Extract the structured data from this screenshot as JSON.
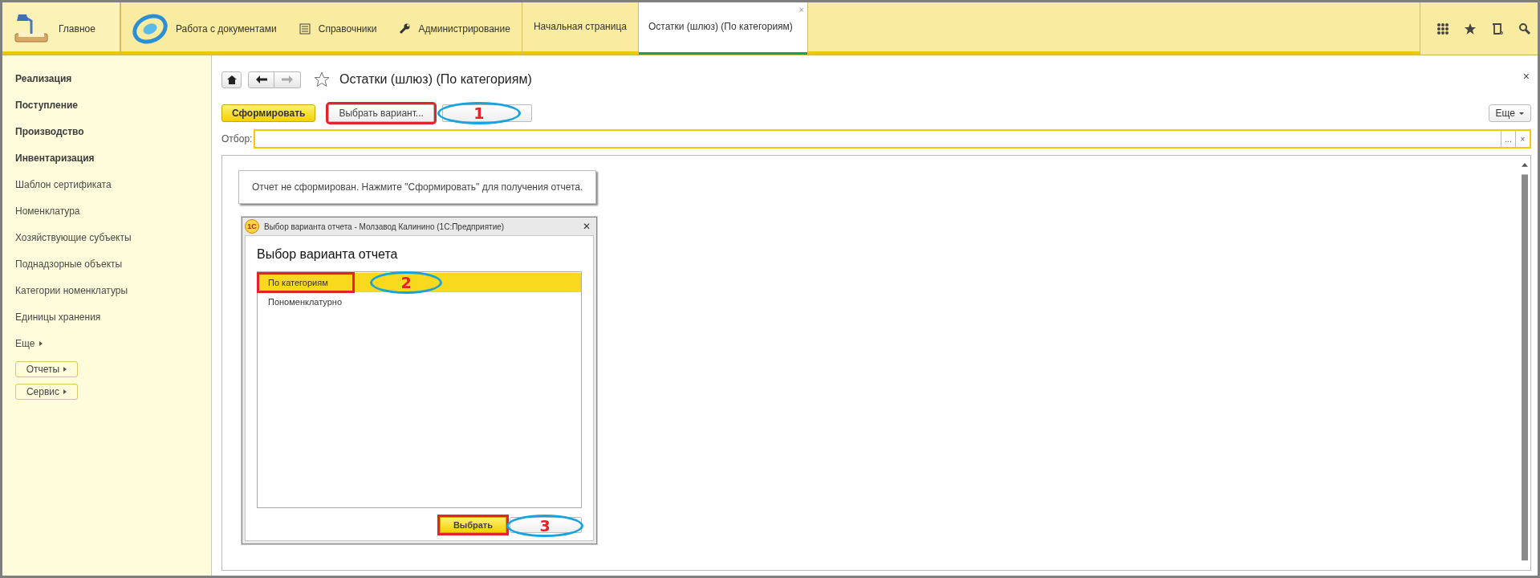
{
  "sections": [
    {
      "label": "Главное",
      "selected": false
    },
    {
      "label": "Работа с документами",
      "selected": false
    },
    {
      "label": "Справочники",
      "selected": false
    },
    {
      "label": "Администрирование",
      "selected": false
    }
  ],
  "open_tabs": [
    {
      "label": "Начальная страница",
      "selected": false
    },
    {
      "label": "Остатки (шлюз) (По категориям)",
      "selected": true,
      "close": "×"
    }
  ],
  "sidebar": {
    "items": [
      {
        "label": "Реализация",
        "bold": true
      },
      {
        "label": "Поступление",
        "bold": true
      },
      {
        "label": "Производство",
        "bold": true
      },
      {
        "label": "Инвентаризация",
        "bold": true
      },
      {
        "label": "Шаблон сертификата",
        "bold": false
      },
      {
        "label": "Номенклатура",
        "bold": false
      },
      {
        "label": "Хозяйствующие субъекты",
        "bold": false
      },
      {
        "label": "Поднадзорные объекты",
        "bold": false
      },
      {
        "label": "Категории номенклатуры",
        "bold": false
      },
      {
        "label": "Единицы хранения",
        "bold": false
      },
      {
        "label": "Еще",
        "bold": false,
        "kind": "more"
      }
    ],
    "buttons": [
      {
        "label": "Отчеты"
      },
      {
        "label": "Сервис"
      }
    ]
  },
  "form": {
    "title": "Остатки (шлюз) (По категориям)",
    "favorite": false,
    "close": "×",
    "toolbar": {
      "generate": "Сформировать",
      "variant": {
        "label": "Выбрать вариант...",
        "highlighted": true,
        "callout": "1"
      },
      "more": "Еще"
    },
    "filter": {
      "label": "Отбор:",
      "select": "...",
      "clear": "×"
    },
    "message": "Отчет не сформирован. Нажмите \"Сформировать\" для получения отчета."
  },
  "dialog": {
    "app_icon": "1С",
    "title": "Выбор варианта отчета - Молзавод Калинино  (1С:Предприятие)",
    "close": "✕",
    "heading": "Выбор варианта отчета",
    "variants": [
      {
        "label": "По категориям",
        "selected": true,
        "highlighted": true,
        "callout": "2"
      },
      {
        "label": "Пономенклатурно",
        "selected": false,
        "highlighted": false
      }
    ],
    "choose": {
      "label": "Выбрать",
      "highlighted": true,
      "callout": "3"
    }
  }
}
